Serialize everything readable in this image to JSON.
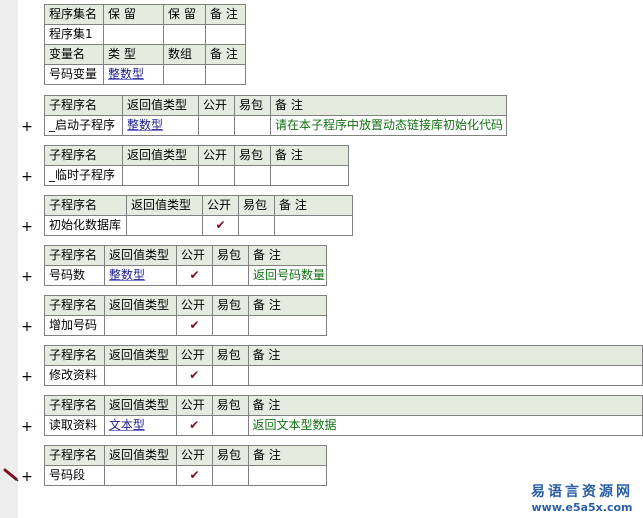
{
  "header_table": {
    "row1": [
      "程序集名",
      "保 留",
      "保 留",
      "备 注"
    ],
    "row2": [
      "程序集1",
      "",
      "",
      ""
    ],
    "row3": [
      "变量名",
      "类 型",
      "数组",
      "备 注"
    ],
    "row4": [
      "号码变量",
      "整数型",
      "",
      ""
    ]
  },
  "sub_headers": [
    "子程序名",
    "返回值类型",
    "公开",
    "易包",
    "备 注"
  ],
  "subs": [
    {
      "name": "_启动子程序",
      "return_type": "整数型",
      "public": "",
      "easy": "",
      "note": "请在本子程序中放置动态链接库初始化代码"
    },
    {
      "name": "_临时子程序",
      "return_type": "",
      "public": "",
      "easy": "",
      "note": ""
    },
    {
      "name": "初始化数据库",
      "return_type": "",
      "public": "✔",
      "easy": "",
      "note": ""
    },
    {
      "name": "号码数",
      "return_type": "整数型",
      "public": "✔",
      "easy": "",
      "note": "返回号码数量"
    },
    {
      "name": "增加号码",
      "return_type": "",
      "public": "✔",
      "easy": "",
      "note": ""
    },
    {
      "name": "修改资料",
      "return_type": "",
      "public": "✔",
      "easy": "",
      "note": ""
    },
    {
      "name": "读取资料",
      "return_type": "文本型",
      "public": "✔",
      "easy": "",
      "note": "返回文本型数据"
    },
    {
      "name": "号码段",
      "return_type": "",
      "public": "✔",
      "easy": "",
      "note": ""
    }
  ],
  "expand_symbol": "+",
  "watermark": {
    "title": "易语言资源网",
    "url": "www.e5a5x.com"
  },
  "icons": {
    "pen": "pencil-icon",
    "check": "check-icon"
  },
  "colors": {
    "header_bg": "#e6ebdf",
    "type_text": "#1b1b8f",
    "note_text": "#107010",
    "check": "#7a1020",
    "watermark": "#2a5fa8"
  }
}
